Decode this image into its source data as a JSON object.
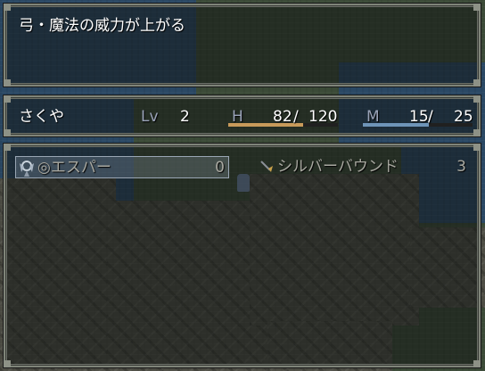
{
  "help": {
    "text": "弓・魔法の威力が上がる"
  },
  "status": {
    "name": "さくや",
    "lv_label": "Lv",
    "lv": "2",
    "hp_label": "H",
    "hp": "82",
    "hp_max": "120",
    "hp_slash": "/",
    "hp_ratio": 0.683,
    "mp_label": "M",
    "mp": "15",
    "mp_max": "25",
    "mp_slash": "/",
    "mp_ratio": 0.6,
    "colors": {
      "hp_gauge": "#c89a5a",
      "mp_gauge": "#6e94b8"
    }
  },
  "skills": [
    {
      "icon": "winged-emblem-icon",
      "name": "◎エスパー",
      "value": "0",
      "selected": true
    },
    {
      "icon": "sword-icon",
      "name": "シルバーバウンド",
      "value": "3",
      "selected": false
    }
  ]
}
